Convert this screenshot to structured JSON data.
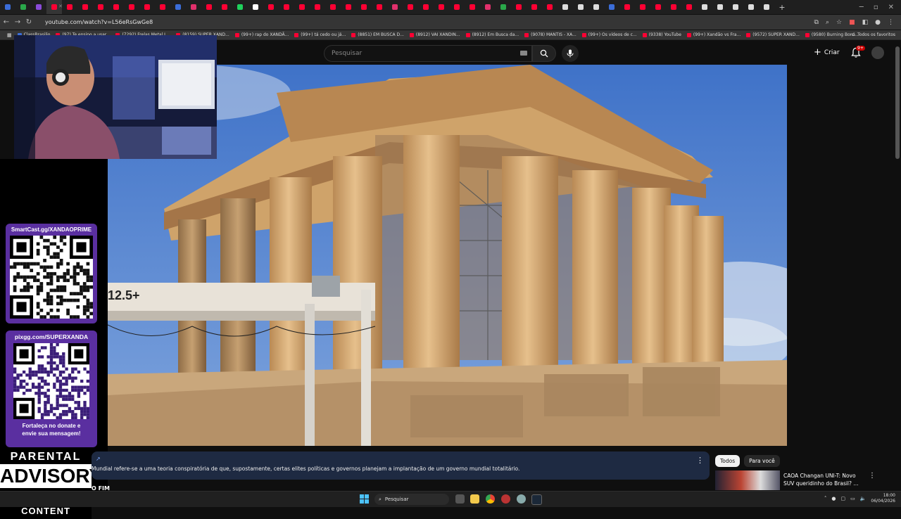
{
  "browser": {
    "url": "youtube.com/watch?v=L56eRsGwGe8",
    "bookmarks": [
      "ClassBrasilio",
      "(97) Te ensino a usar...",
      "(7292) Frelas Metal L...",
      "(8159) SUPER XAND...",
      "(99+) rap do XANDÃ...",
      "(99+) tá cedo ou já...",
      "(8851) EM BUSCA D...",
      "(8912) VAI XANDIN...",
      "(8912) Em Busca da...",
      "(9078) MANTIS - XA...",
      "(99+) Os vídeos de c...",
      "(9338) YouTube",
      "(99+) Xandão vs Fra...",
      "(9572) SUPER XAND...",
      "(9580) Burning Bord..."
    ],
    "all_favorites": "Todos os favoritos"
  },
  "youtube": {
    "search_placeholder": "Pesquisar",
    "create_label": "Criar",
    "notif_badge": "9+",
    "info_text": "Mundial refere-se a uma teoria conspiratória de que, supostamente, certas elites políticas e governos planejam a implantação de um governo mundial totalitário.",
    "below_title": "O FIM",
    "chips": [
      "Todos",
      "Para você"
    ],
    "recommendation": {
      "title": "CAOA Changan UNI-T: Novo SUV queridinho do Brasil? ..."
    },
    "video_overlay_text": "12.5+"
  },
  "stream": {
    "card1_title": "SmartCast.gg/XANDAOPRIME",
    "card2_title": "pixgg.com/SUPERXANDA",
    "card2_footer_line1": "Fortaleça no donate e",
    "card2_footer_line2": "envie sua mensagem!",
    "advisory_line1": "PARENTAL",
    "advisory_line2": "ADVISORY",
    "advisory_line3": "EXPLICIT CONTENT"
  },
  "taskbar": {
    "search_label": "Pesquisar",
    "time": "18:00",
    "date": "06/04/2026"
  },
  "colors": {
    "youtube_red": "#ff0033",
    "qr_card_purple": "#5a2fa0",
    "sky": "#4d7fd1",
    "marble": "#d9b27a"
  }
}
